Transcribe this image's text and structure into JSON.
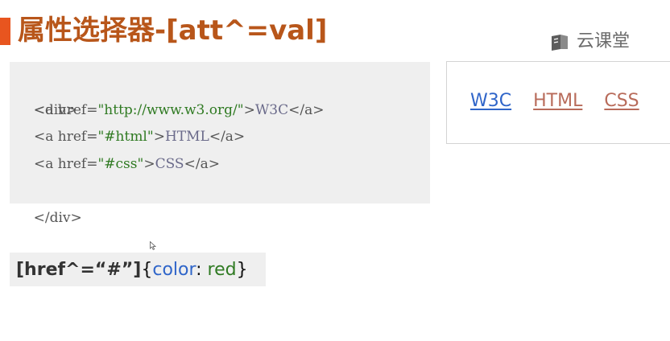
{
  "slide": {
    "title": "属性选择器-[att^=val]",
    "accent_color": "#e8551f",
    "title_color": "#b8561a"
  },
  "brand": {
    "icon": "book-icon",
    "name": "云课堂"
  },
  "code": {
    "line1_open": "<div>",
    "line2": {
      "tag_open": "<a href=",
      "value": "\"http://www.w3.org/\"",
      "tag_close": ">",
      "text": "W3C",
      "end_tag": "</a>"
    },
    "line3": {
      "tag_open": "<a href=",
      "value": "\"#html\"",
      "tag_close": ">",
      "text": "HTML",
      "end_tag": "</a>"
    },
    "line4": {
      "tag_open": "<a href=",
      "value": "\"#css\"",
      "tag_close": ">",
      "text": "CSS",
      "end_tag": "</a>"
    },
    "line5_close": "</div>"
  },
  "preview": {
    "links": [
      {
        "label": "W3C",
        "color": "#2f65c9"
      },
      {
        "label": "HTML",
        "color": "#b86b5a"
      },
      {
        "label": "CSS",
        "color": "#b86b5a"
      }
    ]
  },
  "rule": {
    "selector": "[href^=“#”]",
    "open_brace": "{",
    "property": "color",
    "colon": ": ",
    "value": "red",
    "close_brace": "}"
  }
}
